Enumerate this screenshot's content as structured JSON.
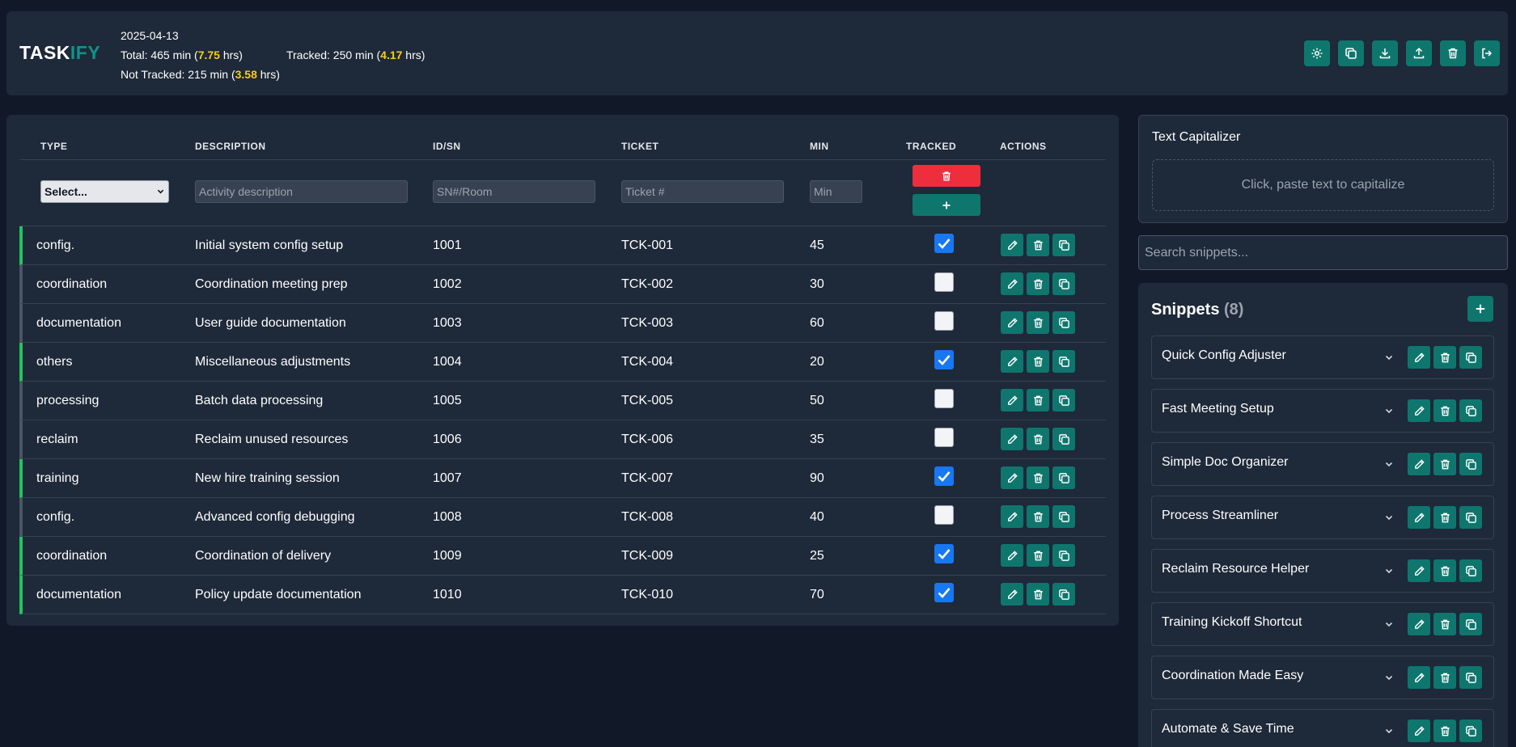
{
  "header": {
    "logo_a": "TASK",
    "logo_b": "IFY",
    "date": "2025-04-13",
    "total_prefix": "Total: 465 min (",
    "total_hrs": "7.75",
    "hrs_suffix": " hrs)",
    "tracked_prefix": "Tracked: 250 min (",
    "tracked_hrs": "4.17",
    "not_tracked_prefix": "Not Tracked: 215 min (",
    "not_tracked_hrs": "3.58"
  },
  "table": {
    "headers": {
      "type": "TYPE",
      "description": "DESCRIPTION",
      "id": "ID/SN",
      "ticket": "TICKET",
      "min": "MIN",
      "tracked": "TRACKED",
      "actions": "ACTIONS"
    },
    "inputs": {
      "type_select": "Select...",
      "description_placeholder": "Activity description",
      "id_placeholder": "SN#/Room",
      "ticket_placeholder": "Ticket #",
      "min_placeholder": "Min"
    },
    "rows": [
      {
        "type": "config.",
        "description": "Initial system config setup",
        "id": "1001",
        "ticket": "TCK-001",
        "min": "45",
        "tracked": true
      },
      {
        "type": "coordination",
        "description": "Coordination meeting prep",
        "id": "1002",
        "ticket": "TCK-002",
        "min": "30",
        "tracked": false
      },
      {
        "type": "documentation",
        "description": "User guide documentation",
        "id": "1003",
        "ticket": "TCK-003",
        "min": "60",
        "tracked": false
      },
      {
        "type": "others",
        "description": "Miscellaneous adjustments",
        "id": "1004",
        "ticket": "TCK-004",
        "min": "20",
        "tracked": true
      },
      {
        "type": "processing",
        "description": "Batch data processing",
        "id": "1005",
        "ticket": "TCK-005",
        "min": "50",
        "tracked": false
      },
      {
        "type": "reclaim",
        "description": "Reclaim unused resources",
        "id": "1006",
        "ticket": "TCK-006",
        "min": "35",
        "tracked": false
      },
      {
        "type": "training",
        "description": "New hire training session",
        "id": "1007",
        "ticket": "TCK-007",
        "min": "90",
        "tracked": true
      },
      {
        "type": "config.",
        "description": "Advanced config debugging",
        "id": "1008",
        "ticket": "TCK-008",
        "min": "40",
        "tracked": false
      },
      {
        "type": "coordination",
        "description": "Coordination of delivery",
        "id": "1009",
        "ticket": "TCK-009",
        "min": "25",
        "tracked": true
      },
      {
        "type": "documentation",
        "description": "Policy update documentation",
        "id": "1010",
        "ticket": "TCK-010",
        "min": "70",
        "tracked": true
      }
    ]
  },
  "capitalizer": {
    "title": "Text Capitalizer",
    "hint": "Click, paste text to capitalize"
  },
  "search": {
    "placeholder": "Search snippets..."
  },
  "snippets": {
    "title": "Snippets",
    "count": "(8)",
    "items": [
      "Quick Config Adjuster",
      "Fast Meeting Setup",
      "Simple Doc Organizer",
      "Process Streamliner",
      "Reclaim Resource Helper",
      "Training Kickoff Shortcut",
      "Coordination Made Easy",
      "Automate & Save Time"
    ]
  },
  "colors": {
    "accent": "#0f766e",
    "danger": "#ef2e3d",
    "highlight": "#facc15",
    "tracked_bar": "#22c55e",
    "checkbox": "#1877f2"
  }
}
